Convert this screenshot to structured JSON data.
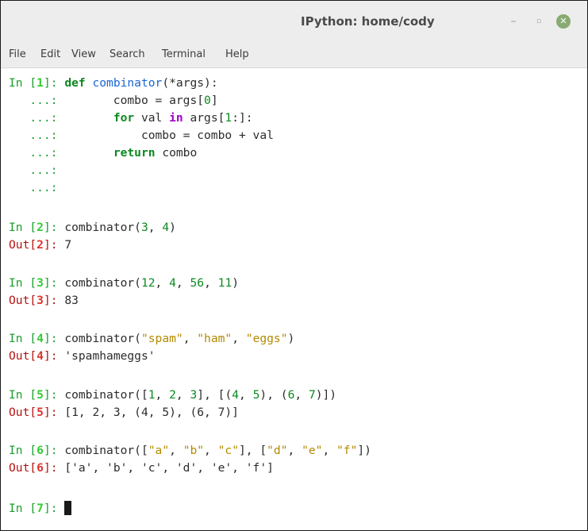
{
  "window": {
    "title": "IPython: home/cody",
    "minimize_glyph": "–",
    "maximize_glyph": "▫",
    "close_glyph": "✕"
  },
  "menu": [
    "File",
    "Edit",
    "View",
    "Search",
    "Terminal",
    "Help"
  ],
  "session": {
    "in1": {
      "label": "In [",
      "num": "1",
      "close": "]: "
    },
    "def_line": {
      "kw": "def",
      "fn": "combinator",
      "rest": "(*args):"
    },
    "cont_prompt": "   ...:",
    "body1": "        combo = args[",
    "body1_num": "0",
    "body1_end": "]",
    "body2_kw": "for",
    "body2_mid": " val ",
    "body2_in": "in",
    "body2_rest": " args[",
    "body2_num": "1",
    "body2_end": ":]:",
    "body3": "            combo = combo + val",
    "body4_kw": "return",
    "body4_rest": " combo",
    "in2": {
      "num": "2",
      "code_pre": "combinator(",
      "a": "3",
      "sep": ", ",
      "b": "4",
      "code_post": ")"
    },
    "out2": {
      "num": "2",
      "value": "7"
    },
    "in3": {
      "num": "3",
      "code_pre": "combinator(",
      "a": "12",
      "b": "4",
      "c": "56",
      "d": "11",
      "sep": ", ",
      "code_post": ")"
    },
    "out3": {
      "num": "3",
      "value": "83"
    },
    "in4": {
      "num": "4",
      "code_pre": "combinator(",
      "a": "\"spam\"",
      "b": "\"ham\"",
      "c": "\"eggs\"",
      "sep": ", ",
      "code_post": ")"
    },
    "out4": {
      "num": "4",
      "value": "'spamhameggs'"
    },
    "in5": {
      "num": "5",
      "code_pre": "combinator([",
      "n1": "1",
      "n2": "2",
      "n3": "3",
      "mid": "], [(",
      "n4": "4",
      "n5": "5",
      "mid2": "), (",
      "n6": "6",
      "n7": "7",
      "code_post": ")])",
      "sep": ", "
    },
    "out5": {
      "num": "5",
      "value": "[1, 2, 3, (4, 5), (6, 7)]"
    },
    "in6": {
      "num": "6",
      "code_pre": "combinator([",
      "a": "\"a\"",
      "b": "\"b\"",
      "c": "\"c\"",
      "mid": "], [",
      "d": "\"d\"",
      "e": "\"e\"",
      "f": "\"f\"",
      "code_post": "])",
      "sep": ", "
    },
    "out6": {
      "num": "6",
      "value": "['a', 'b', 'c', 'd', 'e', 'f']"
    },
    "in7": {
      "num": "7"
    },
    "in_open": "In [",
    "in_close": "]: ",
    "out_open": "Out[",
    "out_close": "]: "
  }
}
